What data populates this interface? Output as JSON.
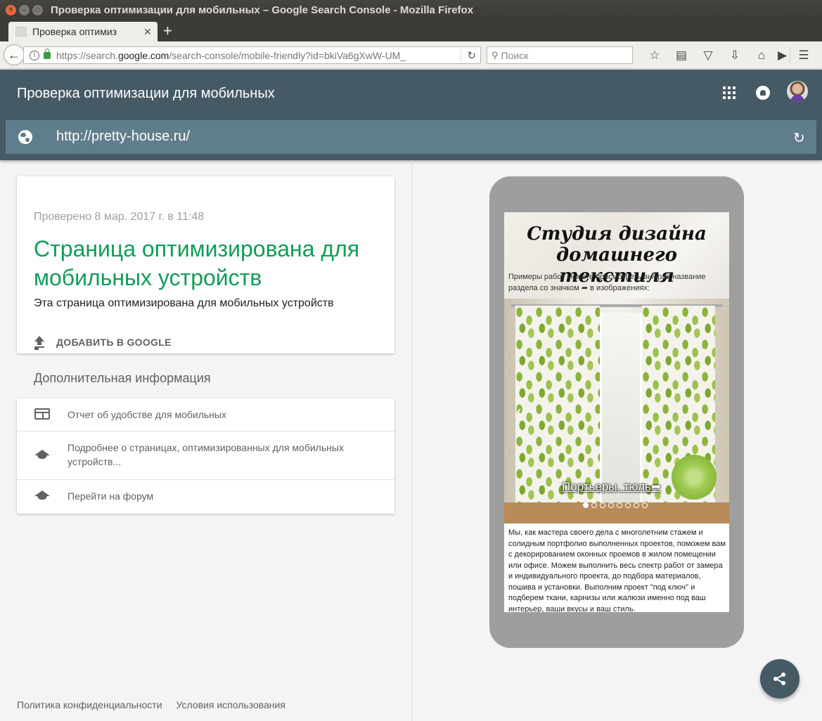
{
  "window": {
    "title": "Проверка оптимизации для мобильных – Google Search Console - Mozilla Firefox",
    "close_glyph": "✕",
    "min_glyph": "–",
    "max_glyph": "□"
  },
  "browser": {
    "tab_title": "Проверка оптимиз",
    "tab_close": "✕",
    "new_tab": "+",
    "url_prefix": "https://search.",
    "url_host": "google.com",
    "url_rest": "/search-console/mobile-friendly?id=bkiVa6gXwW-UM_",
    "search_placeholder": "Поиск",
    "icons": [
      "back-icon",
      "info-icon",
      "lock-icon",
      "reload-icon",
      "search-icon",
      "bookmark-star-icon",
      "reading-list-icon",
      "pocket-icon",
      "download-icon",
      "home-icon",
      "youtube-icon",
      "menu-icon"
    ]
  },
  "header": {
    "title": "Проверка оптимизации для мобильных",
    "tested_url": "http://pretty-house.ru/"
  },
  "result_card": {
    "checked": "Проверено 8 мар. 2017 г. в 11:48",
    "headline": "Страница оптимизирована для мобильных устройств",
    "subtext": "Эта страница оптимизирована для мобильных устройств",
    "add_button": "ДОБАВИТЬ В GOOGLE"
  },
  "more_info": {
    "heading": "Дополнительная информация",
    "items": [
      {
        "label": "Отчет об удобстве для мобильных",
        "icon": "report-icon"
      },
      {
        "label": "Подробнее о страницах, оптимизированных для мобильных устройств...",
        "icon": "school-icon"
      },
      {
        "label": "Перейти на форум",
        "icon": "school-icon"
      }
    ]
  },
  "footer": {
    "privacy": "Политика конфиденциальности",
    "terms": "Условия использования"
  },
  "preview": {
    "hero_title_line1": "Студия дизайна",
    "hero_title_line2": "домашнего текстиля",
    "hero_desc": "Примеры работ можете просмотреть выбрав название раздела со значком ➦ в изображениях:",
    "slide_caption": "Портьеры, тюль➦",
    "slide_count": 8,
    "active_slide": 1,
    "body": "Мы, как мастера своего дела с многолетним стажем и солидным портфолио выполненных проектов, поможем вам с декорированием оконных проемов в жилом помещении или офисе. Можем выполнить весь спектр работ от замера и индивидуального проекта, до подбора материалов, пошива и установки. Выполним проект \"под ключ\" и подберем ткани, карнизы или жалюзи именно под ваш интерьер, ваши вкусы и ваш стиль."
  },
  "colors": {
    "header_bg": "#455a64",
    "url_field_bg": "#607d8b",
    "success": "#0f9d58",
    "phone_frame": "#9e9e9e"
  }
}
